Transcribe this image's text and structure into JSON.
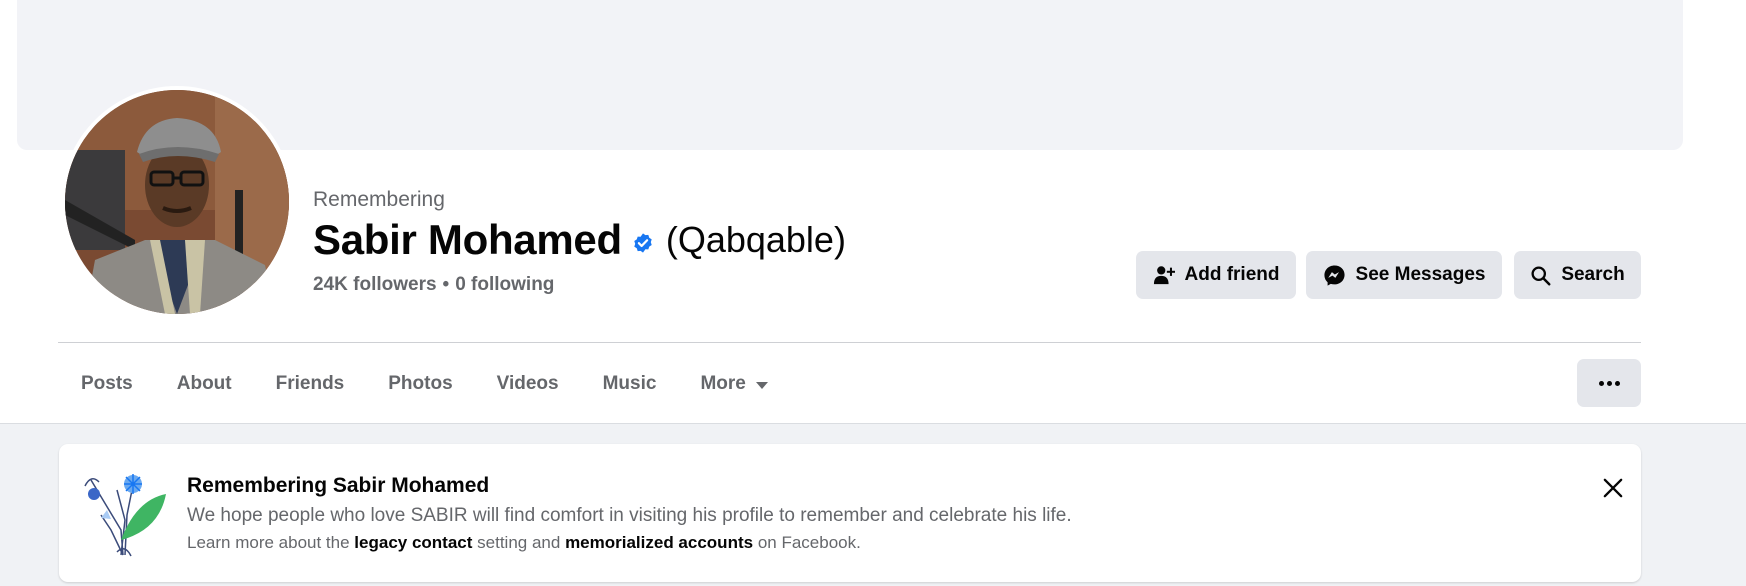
{
  "profile": {
    "status_label": "Remembering",
    "name": "Sabir Mohamed",
    "alternate_name": "(Qabqable)",
    "followers": "24K followers",
    "separator": "•",
    "following": "0 following"
  },
  "actions": {
    "add_friend": "Add friend",
    "see_messages": "See Messages",
    "search": "Search"
  },
  "tabs": [
    "Posts",
    "About",
    "Friends",
    "Photos",
    "Videos",
    "Music",
    "More"
  ],
  "banner": {
    "title": "Remembering Sabir Mohamed",
    "text": "We hope people who love SABIR will find comfort in visiting his profile to remember and celebrate his life.",
    "sub_prefix": "Learn more about the",
    "sub_link1": "legacy contact",
    "sub_middle": "setting and",
    "sub_link2": "memorialized accounts",
    "sub_suffix": "on Facebook."
  },
  "colors": {
    "accent": "#1877f2",
    "button_bg": "#e4e6eb",
    "secondary_text": "#65676b",
    "leaf_green": "#3fb563"
  },
  "icons": {
    "verified": "verified-badge-icon",
    "add_friend": "person-plus-icon",
    "messages": "messenger-icon",
    "search": "search-icon",
    "more": "caret-down-icon",
    "dots": "more-dots-icon",
    "close": "close-icon",
    "flowers": "memorial-flowers-icon"
  }
}
